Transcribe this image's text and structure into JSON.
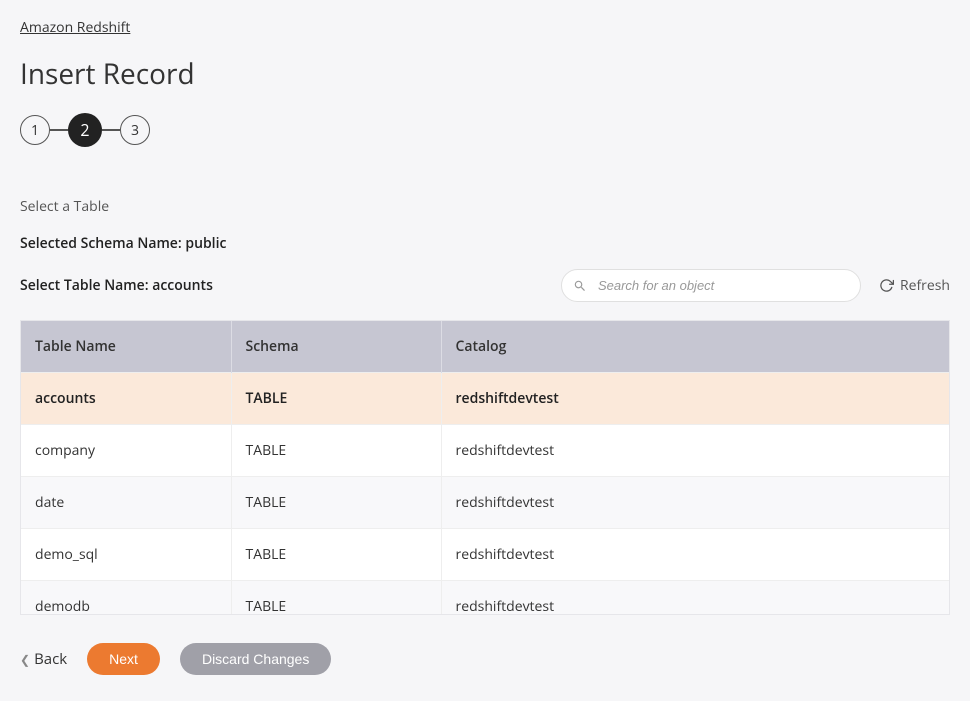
{
  "breadcrumb": {
    "label": "Amazon Redshift"
  },
  "page_title": "Insert Record",
  "stepper": {
    "steps": [
      "1",
      "2",
      "3"
    ],
    "active_index": 1
  },
  "section_label": "Select a Table",
  "selected_schema_line": "Selected Schema Name: public",
  "select_table_line": "Select Table Name: accounts",
  "search": {
    "placeholder": "Search for an object"
  },
  "refresh_label": "Refresh",
  "table": {
    "headers": {
      "name": "Table Name",
      "schema": "Schema",
      "catalog": "Catalog"
    },
    "rows": [
      {
        "name": "accounts",
        "schema": "TABLE",
        "catalog": "redshiftdevtest",
        "selected": true
      },
      {
        "name": "company",
        "schema": "TABLE",
        "catalog": "redshiftdevtest",
        "selected": false
      },
      {
        "name": "date",
        "schema": "TABLE",
        "catalog": "redshiftdevtest",
        "selected": false
      },
      {
        "name": "demo_sql",
        "schema": "TABLE",
        "catalog": "redshiftdevtest",
        "selected": false
      },
      {
        "name": "demodb",
        "schema": "TABLE",
        "catalog": "redshiftdevtest",
        "selected": false
      }
    ]
  },
  "buttons": {
    "back": "Back",
    "next": "Next",
    "discard": "Discard Changes"
  }
}
